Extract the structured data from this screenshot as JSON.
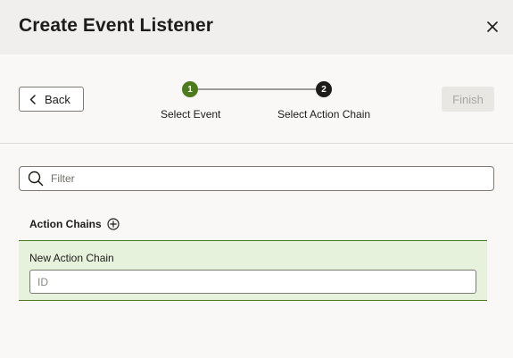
{
  "dialog": {
    "title": "Create Event Listener",
    "close_icon": "close-icon"
  },
  "toolbar": {
    "back_label": "Back",
    "back_icon": "chevron-left-icon",
    "finish_label": "Finish"
  },
  "steps": [
    {
      "number": "1",
      "label": "Select Event",
      "state": "completed",
      "color": "#4d7a1f"
    },
    {
      "number": "2",
      "label": "Select Action Chain",
      "state": "current",
      "color": "#1d1c1a"
    }
  ],
  "filter": {
    "placeholder": "Filter",
    "icon": "search-icon"
  },
  "action_chains": {
    "heading": "Action Chains",
    "add_icon": "add-circle-icon",
    "new_item": {
      "label": "New Action Chain",
      "id_placeholder": "ID"
    }
  },
  "colors": {
    "accent_green": "#4d7a1f",
    "selected_row_bg": "#e6f2dc",
    "header_bg": "#f1efed"
  }
}
